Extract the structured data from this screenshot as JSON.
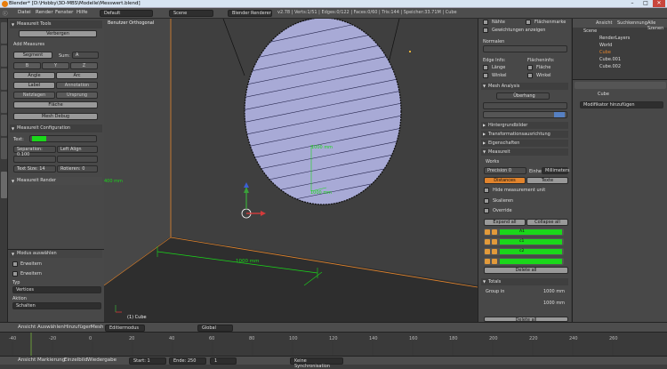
{
  "window": {
    "title": "Blender* [D:\\Hobby\\3D-MBS\\Modelle\\Messwert.blend]"
  },
  "menubar": {
    "items": [
      "Datei",
      "Render",
      "Fenster",
      "Hilfe"
    ],
    "layout": "Default",
    "scene": "Scene",
    "engine": "Blender Renderer",
    "stats": "v2.78 | Verts:1/51 | Edges:0/122 | Faces:0/60 | Tris:144 | Speicher:33.71M | Cube"
  },
  "toolshelf": {
    "header": "Measureit Tools",
    "show_button": "Verbergen",
    "add_header": "Add Measures",
    "segment_label": "Segment",
    "sum_label": "Sum:",
    "sum_value": "A",
    "row_vals": [
      "B",
      "Y",
      "Z"
    ],
    "angle_label": "Angle",
    "arc_label": "Arc",
    "label_label": "Label",
    "annotation_label": "Annotation",
    "mesh_label": "Netzlagen",
    "link_label": "Ursprung",
    "area_label": "Fläche",
    "debug_label": "Mesh Debug",
    "config_header": "Measureit Configuration",
    "text_label": "Text:",
    "separation": "Separation: 0.100",
    "align": "Left Align",
    "text_size": "Text Size:",
    "text_size_val": "14",
    "rotation": "Rotieren:",
    "rotation_val": "0",
    "render_header": "Measureit Render"
  },
  "operator": {
    "header": "Modus auswählen",
    "extend": "Erweitern",
    "extend2": "Erweitern",
    "type_label": "Typ",
    "type_value": "Vertices",
    "action_label": "Aktion",
    "action_value": "Schalten"
  },
  "viewport": {
    "view_label": "Benutzer Orthogonal",
    "object_label": "(1) Cube",
    "measure_text": "1000 mm",
    "measure_text2": "1000 mm",
    "measure_text3": "1000 mm",
    "measure_left": "400 mm"
  },
  "rightpanel": {
    "normals": "Normalen",
    "normals_vals": [
      "Nähte",
      "Flächenmarke",
      "Gewichtungen anzeigen"
    ],
    "edge_info": "Edge Info:",
    "face_info": "Flächeninfo:",
    "length": "Länge",
    "area": "Fläche",
    "angle": "Winkel",
    "angle2": "Winkel",
    "mesh_analysis": "Mesh Analysis",
    "overhang": "Überhang",
    "background": "Hintergrundbilder",
    "transform": "Transformationsausrichtung",
    "properties": "Eigenschaften",
    "measureit": "Measureit",
    "works": "Works",
    "precision": "Precision",
    "precision_val": "0",
    "units": "Einhe",
    "units_val": "Millimeters",
    "distances": "Distances",
    "texts": "Texte",
    "hide_measure": "Hide measurement unit",
    "scale": "Skalieren",
    "override": "Override",
    "expand_all": "Expand all",
    "collapse_all": "Collapse all",
    "rows": [
      "A1",
      "c1",
      "c2",
      ""
    ],
    "delete_all": "Delete all",
    "totals": "Totals",
    "group_in": "Group in",
    "total1": "1000 mm",
    "total2": "1000 mm",
    "delete2": "Delete all"
  },
  "outliner": {
    "tabs": [
      "Ansicht",
      "Suchkennung",
      "Alle Szenen"
    ],
    "items": [
      "Scene",
      "RenderLayers",
      "World",
      "Cube",
      "Cube.001",
      "Cube.002"
    ]
  },
  "props": {
    "object": "Cube",
    "modifier_add": "Modifikator hinzufügen"
  },
  "bottombar": {
    "items": [
      "Ansicht",
      "Auswählen",
      "Hinzufügen",
      "Mesh"
    ],
    "mode": "Editiermodus",
    "pivot": "Global"
  },
  "timeline": {
    "items": [
      "Ansicht",
      "Markierung",
      "Einzelbild",
      "Wiedergabe"
    ],
    "start": "Start:",
    "start_val": "1",
    "end": "Ende:",
    "end_val": "250",
    "current": "1",
    "sync": "Keine Synchronisation",
    "ticks": [
      "-40",
      "-20",
      "0",
      "20",
      "40",
      "60",
      "80",
      "100",
      "120",
      "140",
      "160",
      "180",
      "200",
      "220",
      "240",
      "260"
    ]
  },
  "colors": {
    "accent": "#e2842c",
    "green": "#1ad71a",
    "blue": "#5680c2"
  }
}
